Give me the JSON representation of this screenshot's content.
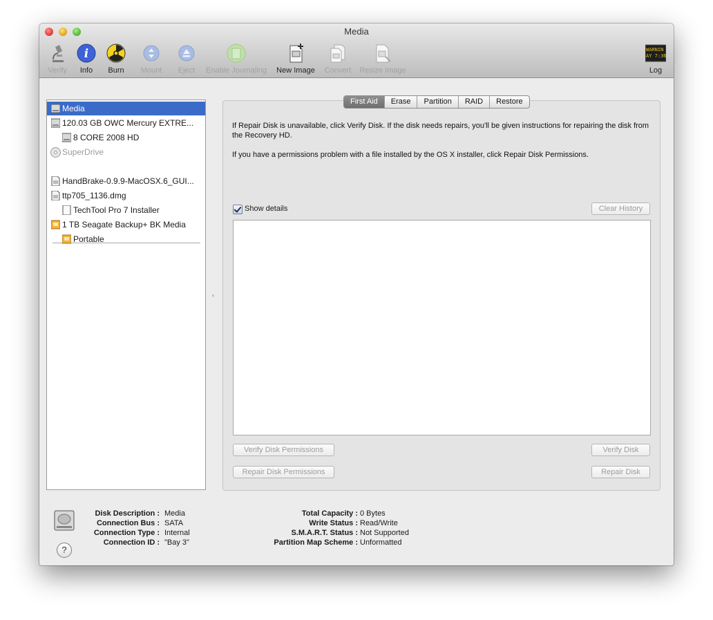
{
  "window": {
    "title": "Media"
  },
  "toolbar": {
    "verify": "Verify",
    "info": "Info",
    "burn": "Burn",
    "mount": "Mount",
    "eject": "Eject",
    "enable_journaling": "Enable Journaling",
    "new_image": "New Image",
    "convert": "Convert",
    "resize_image": "Resize Image",
    "log": "Log",
    "log_icon_text": "WARNIN AY 7:36"
  },
  "sidebar": {
    "items": [
      {
        "label": "Media"
      },
      {
        "label": "120.03 GB OWC Mercury EXTRE..."
      },
      {
        "label": "8 CORE 2008 HD"
      },
      {
        "label": "SuperDrive"
      },
      {
        "label": "HandBrake-0.9.9-MacOSX.6_GUI..."
      },
      {
        "label": "ttp705_1136.dmg"
      },
      {
        "label": "TechTool Pro 7 Installer"
      },
      {
        "label": "1 TB Seagate Backup+ BK Media"
      },
      {
        "label": "Portable"
      }
    ]
  },
  "tabs": [
    "First Aid",
    "Erase",
    "Partition",
    "RAID",
    "Restore"
  ],
  "first_aid": {
    "text1": "If Repair Disk is unavailable, click Verify Disk. If the disk needs repairs, you'll be given instructions for repairing the disk from the Recovery HD.",
    "text2": "If you have a permissions problem with a file installed by the OS X installer, click Repair Disk Permissions.",
    "show_details": "Show details",
    "clear_history": "Clear History",
    "verify_perms": "Verify Disk Permissions",
    "repair_perms": "Repair Disk Permissions",
    "verify_disk": "Verify Disk",
    "repair_disk": "Repair Disk"
  },
  "info_left": [
    {
      "label": "Disk Description :",
      "value": "Media"
    },
    {
      "label": "Connection Bus :",
      "value": "SATA"
    },
    {
      "label": "Connection Type :",
      "value": "Internal"
    },
    {
      "label": "Connection ID :",
      "value": "\"Bay 3\""
    }
  ],
  "info_right": [
    {
      "label": "Total Capacity :",
      "value": "0 Bytes"
    },
    {
      "label": "Write Status :",
      "value": "Read/Write"
    },
    {
      "label": "S.M.A.R.T. Status :",
      "value": "Not Supported"
    },
    {
      "label": "Partition Map Scheme :",
      "value": "Unformatted"
    }
  ],
  "help": "?"
}
